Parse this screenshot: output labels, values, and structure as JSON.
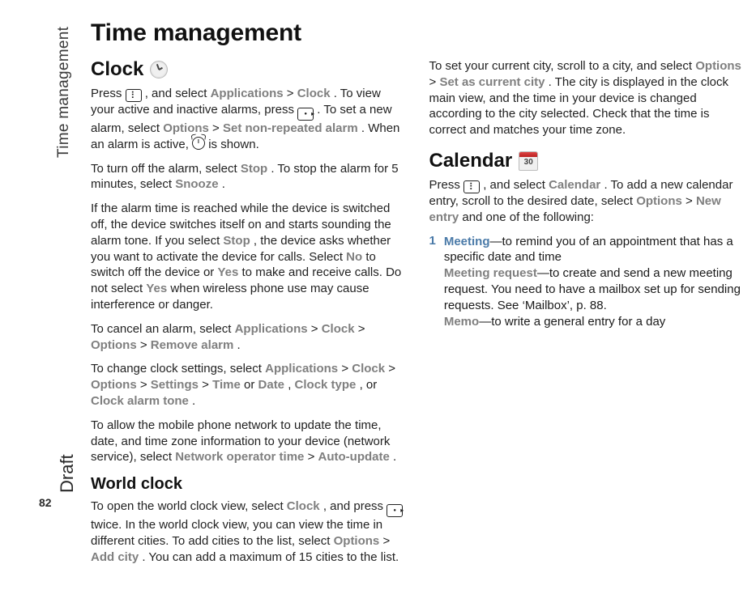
{
  "side": {
    "chapter": "Time management",
    "draft": "Draft",
    "page": "82"
  },
  "title": "Time management",
  "clock": {
    "heading": "Clock",
    "p1": {
      "t1": "Press ",
      "t2": " , and select ",
      "ui_applications": "Applications",
      "gt1": " > ",
      "ui_clock": "Clock",
      "t3": ". To view your active and inactive alarms, press ",
      "t4": ". To set a new alarm, select ",
      "ui_options": "Options",
      "gt2": " > ",
      "ui_setnon": "Set non-repeated alarm",
      "t5": ". When an alarm is active, ",
      "t6": " is shown."
    },
    "p2": {
      "t1": "To turn off the alarm, select ",
      "ui_stop": "Stop",
      "t2": ". To stop the alarm for 5 minutes, select ",
      "ui_snooze": "Snooze",
      "t3": "."
    },
    "p3": {
      "t1": "If the alarm time is reached while the device is switched off, the device switches itself on and starts sounding the alarm tone. If you select ",
      "ui_stop": "Stop",
      "t2": ", the device asks whether you want to activate the device for calls. Select ",
      "ui_no": "No",
      "t3": " to switch off the device or ",
      "ui_yes": "Yes",
      "t4": " to make and receive calls. Do not select ",
      "ui_yes2": "Yes",
      "t5": " when wireless phone use may cause interference or danger."
    },
    "p4": {
      "t1": "To cancel an alarm, select ",
      "ui_applications": "Applications",
      "gt1": " > ",
      "ui_clock": "Clock",
      "gt2": " > ",
      "ui_options": "Options",
      "gt3": " > ",
      "ui_remove": "Remove alarm",
      "t2": "."
    },
    "p5": {
      "t1": "To change clock settings, select ",
      "ui_applications": "Applications",
      "gt1": " > ",
      "ui_clock": "Clock",
      "gt2": " > ",
      "ui_options": "Options",
      "gt3": " > ",
      "ui_settings": "Settings",
      "gt4": " > ",
      "ui_time": "Time",
      "t2": " or ",
      "ui_date": "Date",
      "t3": ", ",
      "ui_clocktype": "Clock type",
      "t4": ", or ",
      "ui_clockalarmtone": "Clock alarm tone",
      "t5": "."
    },
    "p6": {
      "t1": "To allow the mobile phone network to update the time, date, and time zone information to your device (network service), select ",
      "ui_netop": "Network operator time",
      "gt1": " > ",
      "ui_auto": "Auto-update",
      "t2": "."
    }
  },
  "worldclock": {
    "heading": "World clock",
    "p1": {
      "t1": "To open the world clock view, select ",
      "ui_clock": "Clock",
      "t2": ", and press ",
      "t3": " twice. In the world clock view, you can view the time in different cities. To add cities to the list, select ",
      "ui_options": "Options",
      "gt1": " > ",
      "ui_addcity": "Add city",
      "t4": ". You can add a maximum of 15 cities to the list."
    },
    "p2": {
      "t1": "To set your current city, scroll to a city, and select ",
      "ui_options": "Options",
      "gt1": " > ",
      "ui_setcurrent": "Set as current city",
      "t2": ". The city is displayed in the clock main view, and the time in your device is changed according to the city selected. Check that the time is correct and matches your time zone."
    }
  },
  "calendar": {
    "heading": "Calendar",
    "p1": {
      "t1": "Press ",
      "t2": " , and select ",
      "ui_calendar": "Calendar",
      "t3": ". To add a new calendar entry, scroll to the desired date, select ",
      "ui_options": "Options",
      "gt1": " > ",
      "ui_newentry": "New entry",
      "t4": " and one of the following:"
    },
    "list1": {
      "num": "1",
      "ui_meeting": "Meeting",
      "t1": "—to remind you of an appointment that has a specific date and time",
      "ui_meetingreq": "Meeting request",
      "t2": "—to create and send a new meeting request. You need to have a mailbox set up for sending requests. See ‘Mailbox’, p. 88.",
      "ui_memo": "Memo",
      "t3": "—to write a general entry for a day"
    }
  }
}
